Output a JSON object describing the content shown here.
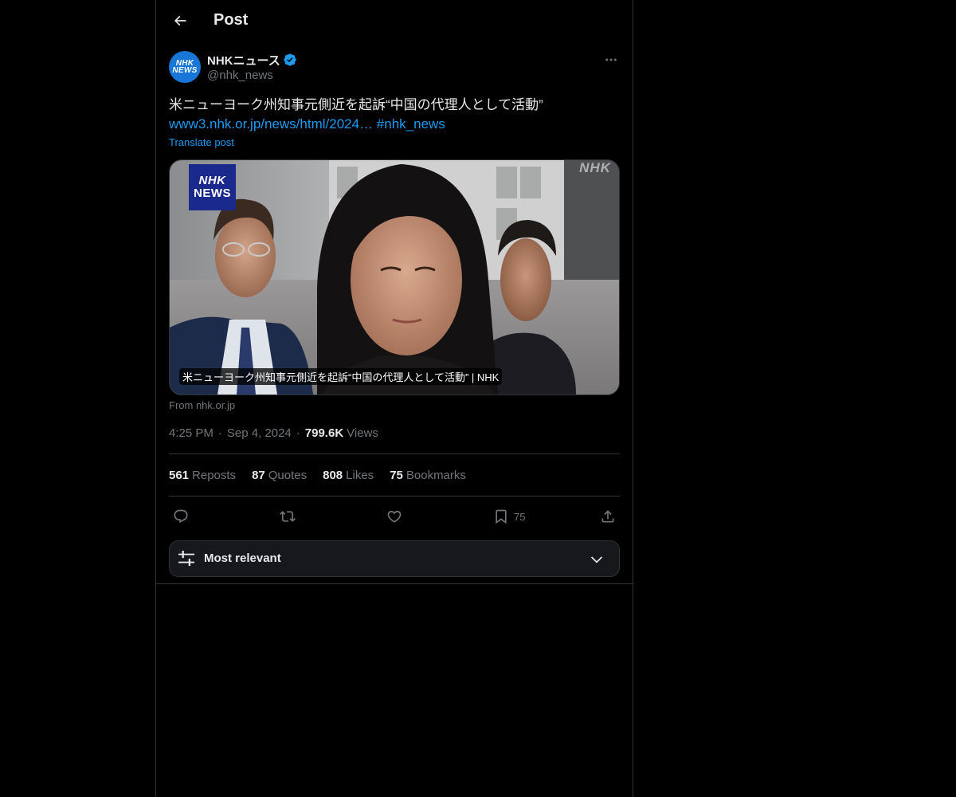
{
  "header": {
    "back_icon": "arrow-left-icon",
    "title": "Post"
  },
  "author": {
    "avatar_line1": "NHK",
    "avatar_line2": "NEWS",
    "display_name": "NHKニュース",
    "verified_icon": "verified-badge-icon",
    "verified_color": "#1d9bf0",
    "handle": "@nhk_news",
    "more_icon": "more-horizontal-icon"
  },
  "post": {
    "text": "米ニューヨーク州知事元側近を起訴“中国の代理人として活動”",
    "link": "www3.nhk.or.jp/news/html/2024…",
    "hashtag": "#nhk_news",
    "translate": "Translate post"
  },
  "card": {
    "logo_line1": "NHK",
    "logo_line2": "NEWS",
    "watermark": "NHK",
    "caption": "米ニューヨーク州知事元側近を起訴“中国の代理人として活動” | NHK",
    "from": "From nhk.or.jp"
  },
  "meta": {
    "time": "4:25 PM",
    "date": "Sep 4, 2024",
    "views_count": "799.6K",
    "views_label": "Views"
  },
  "stats": {
    "reposts_count": "561",
    "reposts_label": "Reposts",
    "quotes_count": "87",
    "quotes_label": "Quotes",
    "likes_count": "808",
    "likes_label": "Likes",
    "bookmarks_count": "75",
    "bookmarks_label": "Bookmarks"
  },
  "actions": {
    "reply_icon": "reply-icon",
    "repost_icon": "repost-icon",
    "like_icon": "heart-icon",
    "bookmark_icon": "bookmark-icon",
    "bookmark_count": "75",
    "share_icon": "share-icon"
  },
  "sort": {
    "icon": "sliders-icon",
    "label": "Most relevant",
    "chevron": "chevron-down-icon"
  },
  "colors": {
    "background": "#000000",
    "text": "#e7e9ea",
    "muted": "#71767b",
    "accent": "#1d9bf0",
    "border": "#2f3336"
  }
}
